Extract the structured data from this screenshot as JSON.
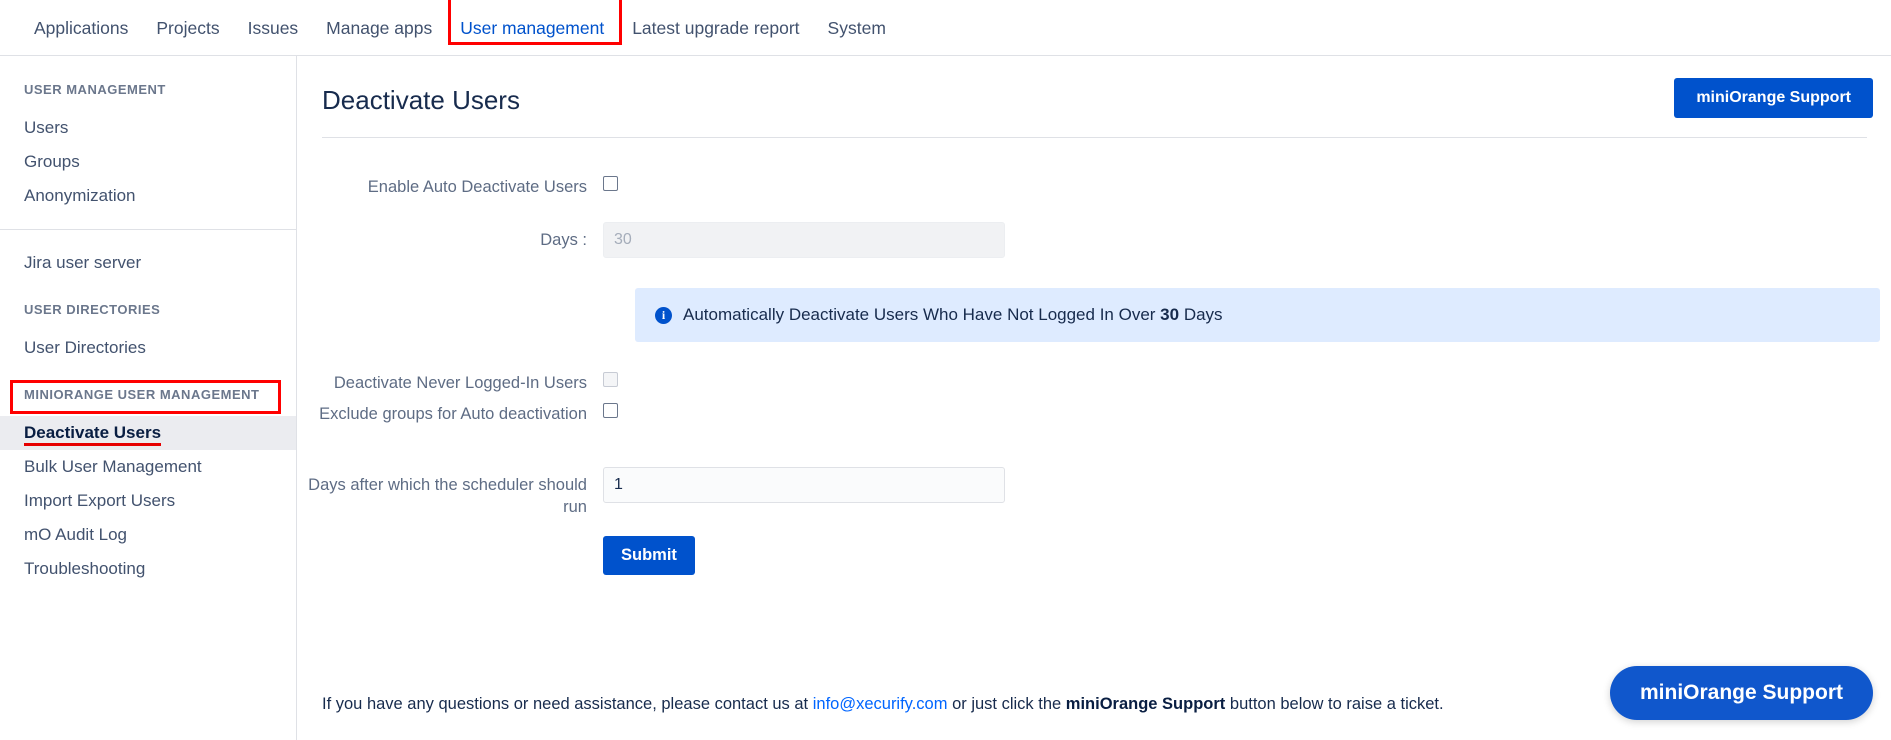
{
  "topnav": {
    "items": [
      {
        "label": "Applications",
        "active": false,
        "highlighted": false
      },
      {
        "label": "Projects",
        "active": false,
        "highlighted": false
      },
      {
        "label": "Issues",
        "active": false,
        "highlighted": false
      },
      {
        "label": "Manage apps",
        "active": false,
        "highlighted": false
      },
      {
        "label": "User management",
        "active": true,
        "highlighted": true
      },
      {
        "label": "Latest upgrade report",
        "active": false,
        "highlighted": false
      },
      {
        "label": "System",
        "active": false,
        "highlighted": false
      }
    ]
  },
  "sidebar": {
    "group1_heading": "USER MANAGEMENT",
    "group1_items": [
      "Users",
      "Groups",
      "Anonymization"
    ],
    "group2_items": [
      "Jira user server"
    ],
    "group3_heading": "USER DIRECTORIES",
    "group3_items": [
      "User Directories"
    ],
    "group4_heading": "MINIORANGE USER MANAGEMENT",
    "group4_items": [
      "Deactivate Users",
      "Bulk User Management",
      "Import Export Users",
      "mO Audit Log",
      "Troubleshooting"
    ],
    "active_item": "Deactivate Users"
  },
  "header": {
    "title": "Deactivate Users",
    "support_button": "miniOrange Support"
  },
  "form": {
    "enable_auto_label": "Enable Auto Deactivate Users",
    "enable_auto_checked": false,
    "days_label": "Days :",
    "days_value": "30",
    "days_placeholder": "30",
    "days_disabled": true,
    "banner_icon": "info-icon",
    "banner_text_before": "Automatically Deactivate Users Who Have Not Logged In Over",
    "banner_text_bold": "30",
    "banner_text_after": "Days",
    "never_logged_label": "Deactivate Never Logged-In Users",
    "never_logged_checked": false,
    "never_logged_disabled": true,
    "exclude_groups_label": "Exclude groups for Auto deactivation",
    "exclude_groups_checked": false,
    "scheduler_label": "Days after which the scheduler should run",
    "scheduler_value": "1",
    "submit_label": "Submit"
  },
  "footer": {
    "text_1": "If you have any questions or need assistance, please contact us at",
    "email": "info@xecurify.com",
    "text_2": "or just click the",
    "brand": "miniOrange Support",
    "text_3": "button below to raise a ticket.",
    "float_button": "miniOrange Support"
  },
  "colors": {
    "accent_blue": "#0052cc",
    "highlight_red": "#ff0000",
    "banner_blue": "#deebff",
    "link_blue": "#0065ff"
  }
}
